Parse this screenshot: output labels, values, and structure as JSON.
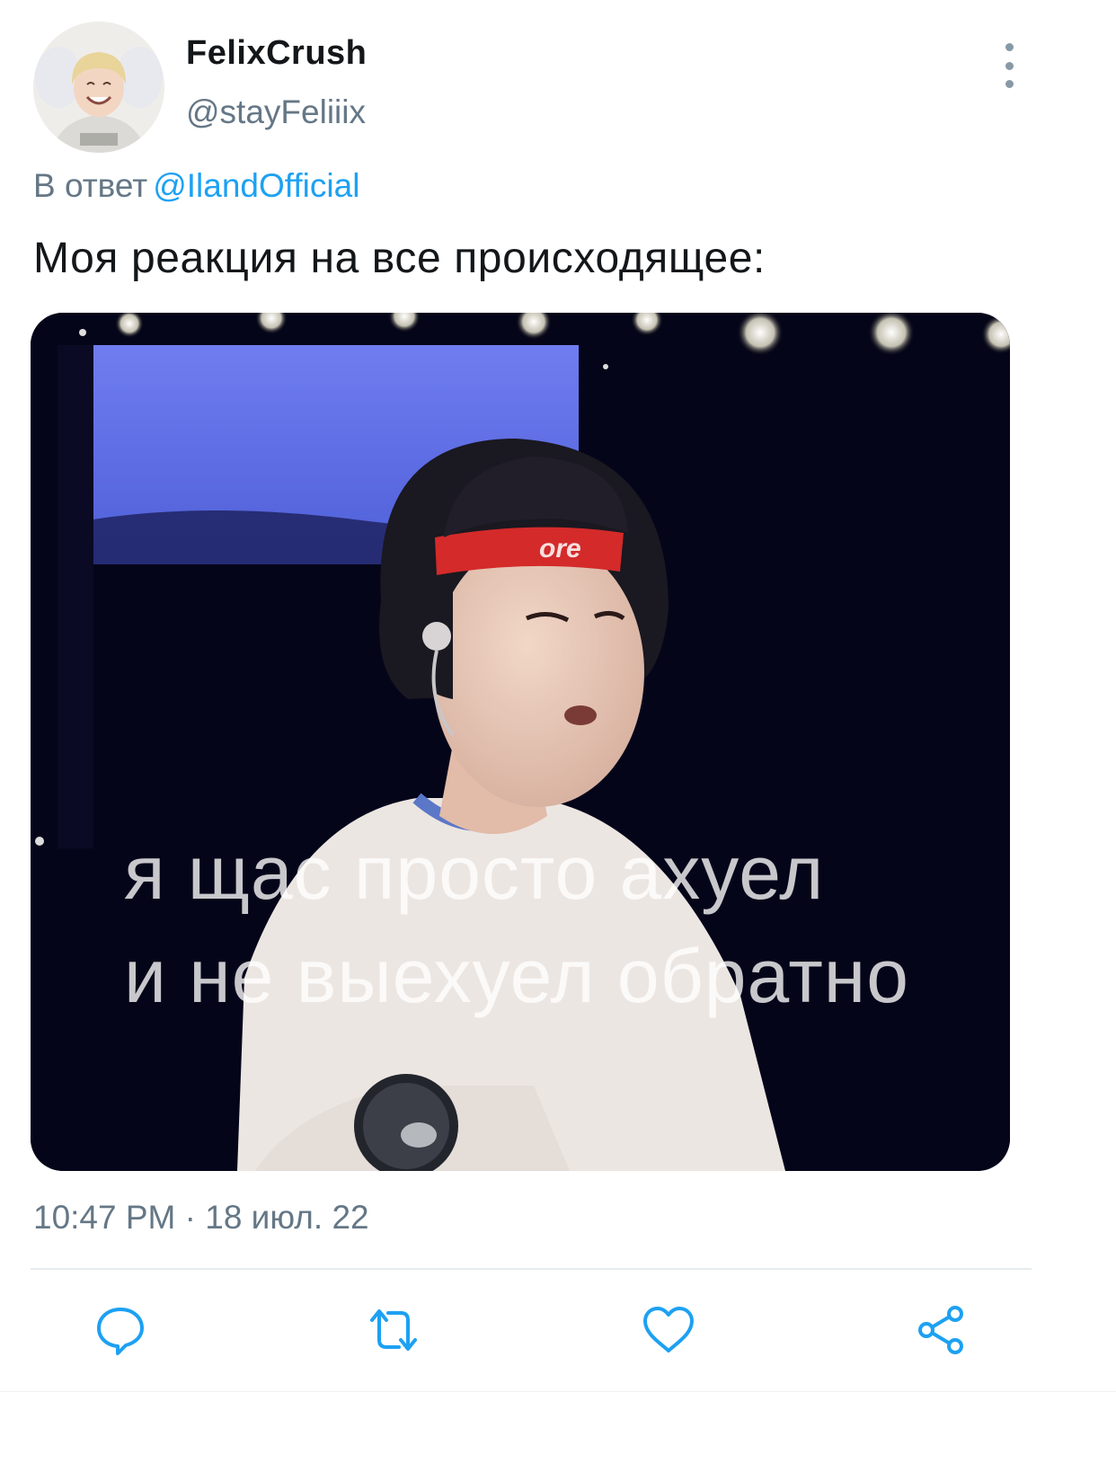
{
  "tweet": {
    "display_name": "FelixCrush",
    "handle": "@stayFeliiix",
    "reply_prefix": "В ответ",
    "reply_mention": "@IlandOfficial",
    "text": "Моя реакция на все происходящее:",
    "timestamp": "10:47 PM · 18 июл. 22"
  },
  "media": {
    "caption_line1": "я щас просто ахуел",
    "caption_line2": "и не выехуел обратно",
    "headband_text": "ore"
  },
  "actions": {
    "reply_icon": "speech-bubble-icon",
    "retweet_icon": "retweet-icon",
    "like_icon": "heart-icon",
    "share_icon": "share-icon"
  },
  "colors": {
    "text": "#14171a",
    "secondary": "#657786",
    "link": "#1da1f2",
    "icon": "#1da1f2"
  }
}
